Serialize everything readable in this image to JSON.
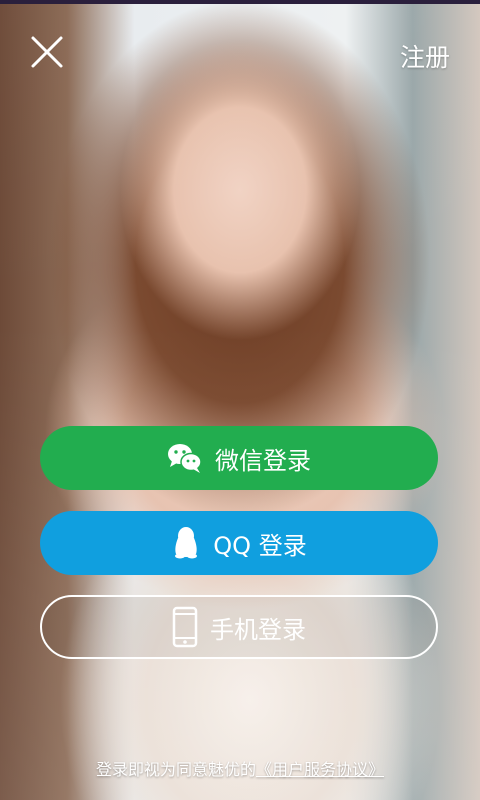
{
  "header": {
    "close_icon": "close-icon",
    "register_label": "注册"
  },
  "login_options": {
    "wechat": {
      "label": "微信登录",
      "icon": "wechat-icon",
      "color": "#22ad4f"
    },
    "qq": {
      "label": "QQ 登录",
      "icon": "qq-penguin-icon",
      "color": "#109fdf"
    },
    "phone": {
      "label": "手机登录",
      "icon": "phone-icon",
      "color": "#ffffff"
    }
  },
  "footer": {
    "agreement_prefix": "登录即视为同意魅优的",
    "agreement_link": "《用户服务协议》"
  }
}
